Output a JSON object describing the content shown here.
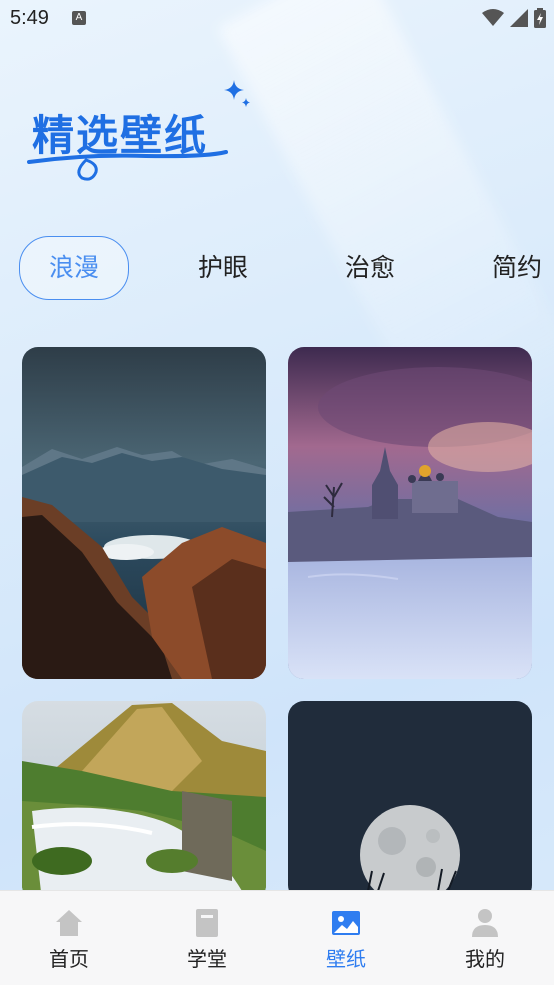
{
  "status_bar": {
    "time": "5:49",
    "notification_letter": "A"
  },
  "header": {
    "title": "精选壁纸"
  },
  "tabs": [
    {
      "label": "浪漫",
      "active": true
    },
    {
      "label": "护眼",
      "active": false
    },
    {
      "label": "治愈",
      "active": false
    },
    {
      "label": "简约",
      "active": false
    }
  ],
  "wallpapers": [
    {
      "subject": "mountain range above clouds"
    },
    {
      "subject": "kremlin in snow at dusk"
    },
    {
      "subject": "waterfall and green mountain"
    },
    {
      "subject": "full moon over grass"
    }
  ],
  "bottom_nav": [
    {
      "label": "首页",
      "icon": "home-icon",
      "active": false
    },
    {
      "label": "学堂",
      "icon": "book-icon",
      "active": false
    },
    {
      "label": "壁纸",
      "icon": "image-icon",
      "active": true
    },
    {
      "label": "我的",
      "icon": "person-icon",
      "active": false
    }
  ],
  "colors": {
    "accent": "#2f7df0",
    "title": "#1f6fe3",
    "inactive_icon": "#c4c4c4"
  }
}
